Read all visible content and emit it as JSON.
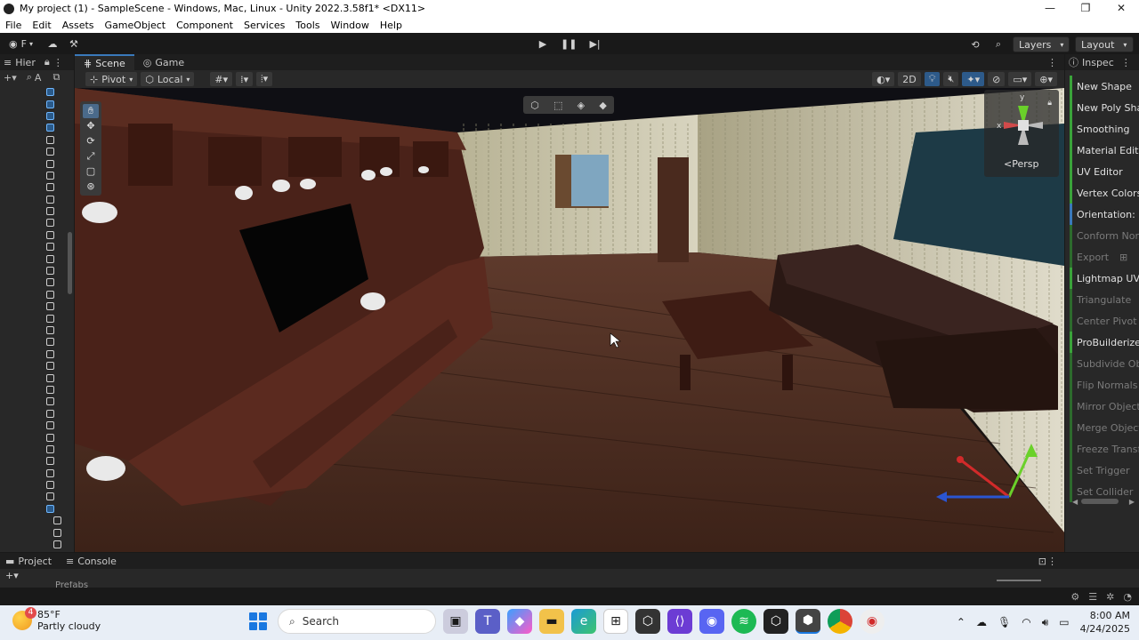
{
  "window": {
    "title": "My project (1) - SampleScene - Windows, Mac, Linux - Unity 2022.3.58f1* <DX11>",
    "controls": [
      "—",
      "❐",
      "✕"
    ]
  },
  "menu": [
    "File",
    "Edit",
    "Assets",
    "GameObject",
    "Component",
    "Services",
    "Tools",
    "Window",
    "Help"
  ],
  "toolbar": {
    "account_letter": "F",
    "layers_label": "Layers",
    "layout_label": "Layout"
  },
  "hierarchy": {
    "tab_label": "Hier",
    "search_glyph": "A"
  },
  "scene": {
    "tabs": [
      "Scene",
      "Game"
    ],
    "pivot_label": "Pivot",
    "local_label": "Local",
    "mode_2d": "2D",
    "persp_label": "<Persp",
    "gizmo_axis_y": "y",
    "gizmo_axis_x": "x"
  },
  "inspector": {
    "tab_label": "Inspec",
    "items": [
      {
        "label": "New Shape",
        "state": "enabled"
      },
      {
        "label": "New Poly Shap",
        "state": "enabled"
      },
      {
        "label": "Smoothing",
        "state": "enabled"
      },
      {
        "label": "Material Editor",
        "state": "enabled"
      },
      {
        "label": "UV Editor",
        "state": "enabled"
      },
      {
        "label": "Vertex Colors",
        "state": "enabled"
      },
      {
        "label": "Orientation: Loc",
        "state": "blue"
      },
      {
        "label": "Conform Norma",
        "state": "disabled"
      },
      {
        "label": "Export",
        "state": "disabled"
      },
      {
        "label": "Lightmap UVs",
        "state": "enabled"
      },
      {
        "label": "Triangulate",
        "state": "disabled"
      },
      {
        "label": "Center Pivot",
        "state": "disabled"
      },
      {
        "label": "ProBuilderize",
        "state": "enabled"
      },
      {
        "label": "Subdivide Obje",
        "state": "disabled"
      },
      {
        "label": "Flip Normals",
        "state": "disabled"
      },
      {
        "label": "Mirror Objects",
        "state": "disabled"
      },
      {
        "label": "Merge Objects",
        "state": "disabled"
      },
      {
        "label": "Freeze Transfo",
        "state": "disabled"
      },
      {
        "label": "Set Trigger",
        "state": "disabled"
      },
      {
        "label": "Set Collider",
        "state": "disabled"
      }
    ]
  },
  "bottom": {
    "tabs": [
      "Project",
      "Console"
    ],
    "folder_label": "Prefabs"
  },
  "taskbar": {
    "weather_temp": "85°F",
    "weather_desc": "Partly cloudy",
    "weather_badge": "4",
    "search_label": "Search",
    "time": "8:00 AM",
    "date": "4/24/2025"
  },
  "colors": {
    "accent": "#3a79bb",
    "probuilder_green": "#3aa33a"
  }
}
